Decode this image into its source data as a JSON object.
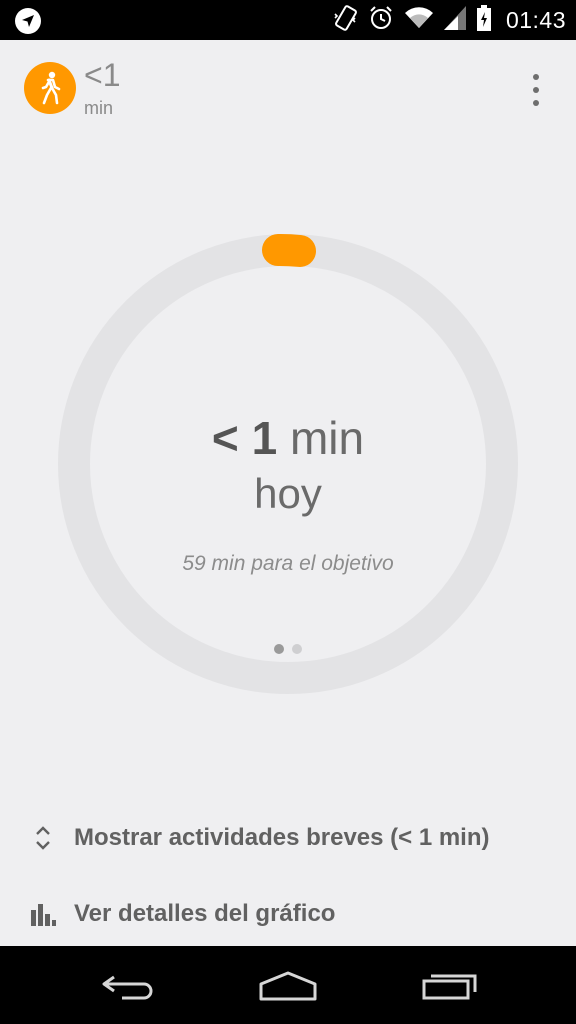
{
  "status_bar": {
    "time": "01:43",
    "icons": [
      "navigation-icon",
      "vibrate-icon",
      "alarm-icon",
      "wifi-icon",
      "signal-icon",
      "battery-icon"
    ]
  },
  "header": {
    "activity_icon": "walking-icon",
    "value": "<1",
    "unit": "min"
  },
  "ring": {
    "value_num": "< 1",
    "value_unit": "min",
    "day": "hoy",
    "goal_text": "59 min para el objetivo",
    "progress_color": "#ff9800",
    "track_color": "#e3e3e5",
    "pages": 2,
    "active_page": 1
  },
  "options": [
    {
      "icon": "expand-collapse-icon",
      "label": "Mostrar actividades breves (< 1 min)"
    },
    {
      "icon": "bar-chart-icon",
      "label": "Ver detalles del gráfico"
    }
  ],
  "navbar": {
    "buttons": [
      "back-icon",
      "home-icon",
      "recents-icon"
    ]
  },
  "colors": {
    "accent": "#ff9800",
    "background": "#efeff1"
  }
}
